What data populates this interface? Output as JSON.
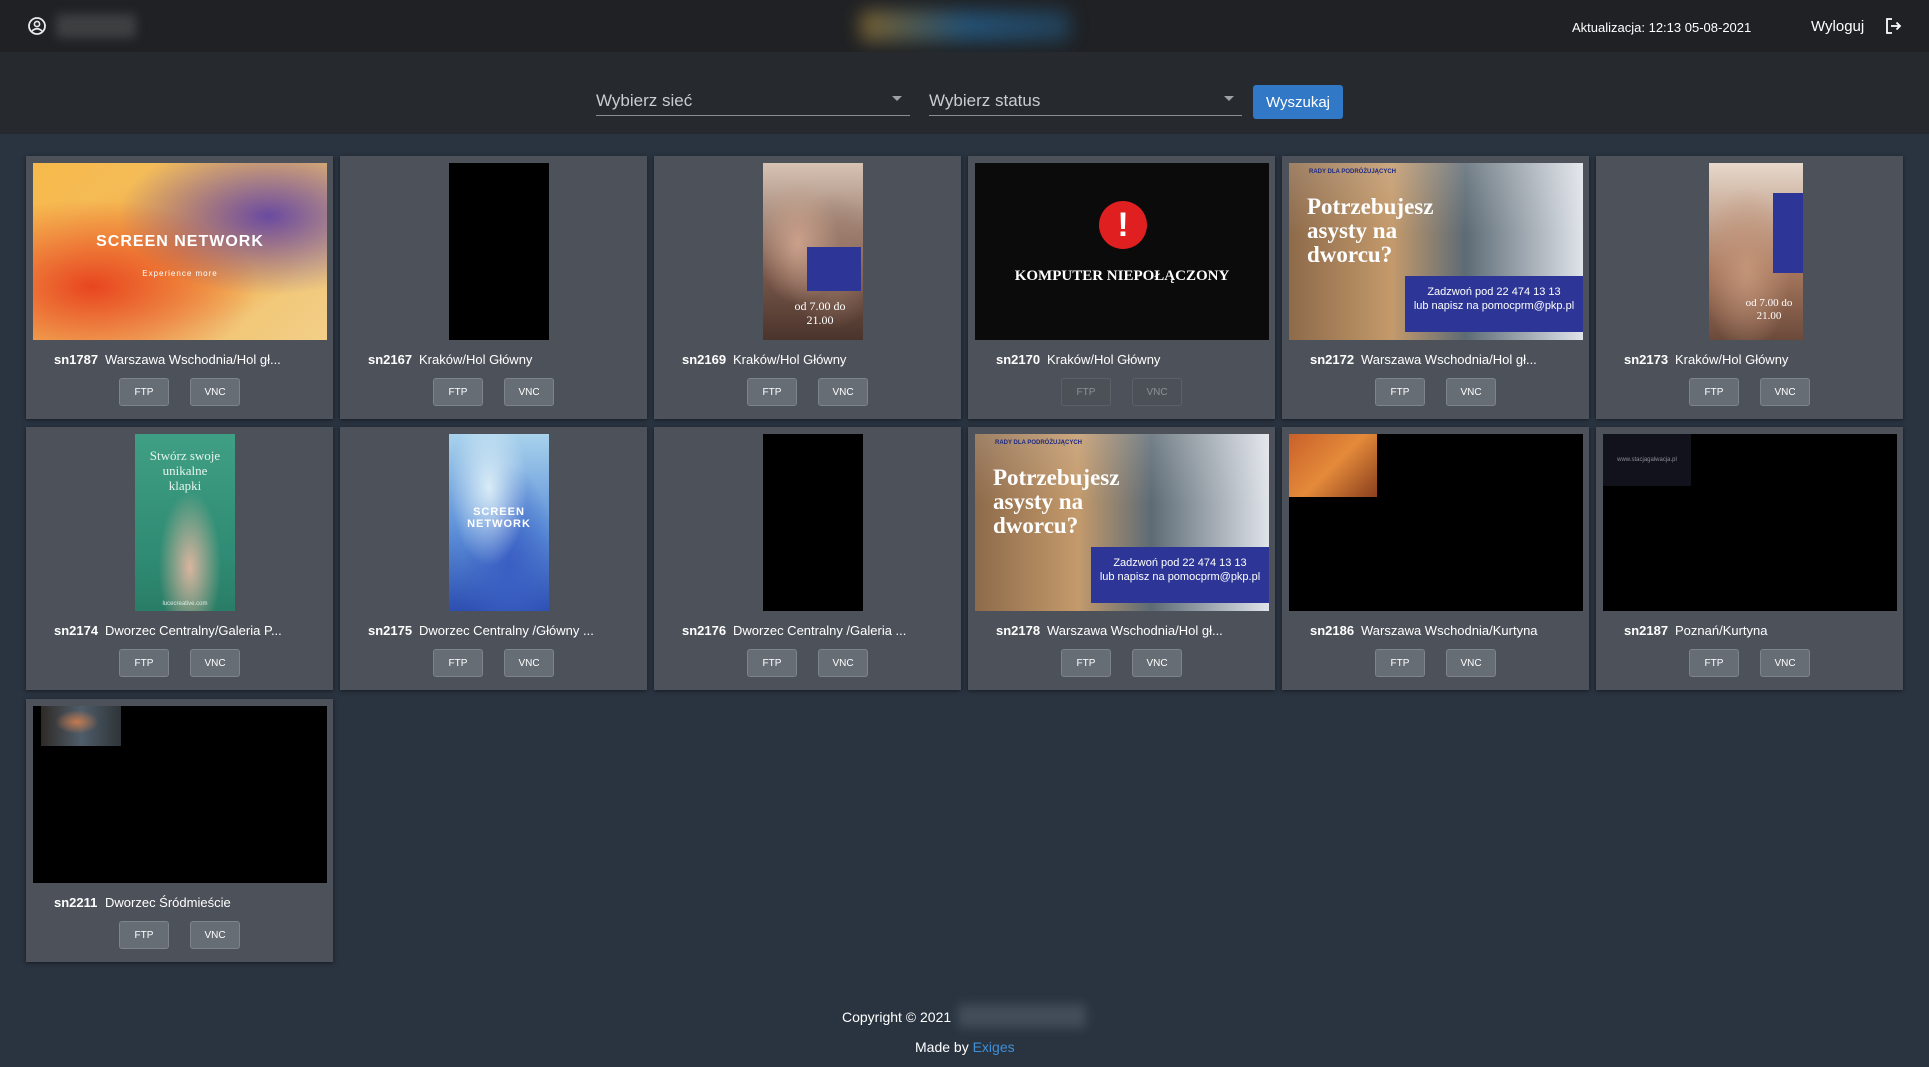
{
  "header": {
    "update_label": "Aktualizacja: 12:13 05-08-2021",
    "logout_label": "Wyloguj"
  },
  "filters": {
    "network_placeholder": "Wybierz sieć",
    "status_placeholder": "Wybierz status",
    "search_label": "Wyszukaj"
  },
  "buttons": {
    "ftp": "FTP",
    "vnc": "VNC"
  },
  "screens": [
    {
      "id": "sn1787",
      "location": "Warszawa Wschodnia/Hol gł...",
      "thumb": "screen-network-orange"
    },
    {
      "id": "sn2167",
      "location": "Kraków/Hol Główny",
      "thumb": "black-portrait"
    },
    {
      "id": "sn2169",
      "location": "Kraków/Hol Główny",
      "thumb": "kids-portrait"
    },
    {
      "id": "sn2170",
      "location": "Kraków/Hol Główny",
      "thumb": "offline",
      "disabled": true
    },
    {
      "id": "sn2172",
      "location": "Warszawa Wschodnia/Hol gł...",
      "thumb": "pkp-ad"
    },
    {
      "id": "sn2173",
      "location": "Kraków/Hol Główny",
      "thumb": "kids-portrait-2"
    },
    {
      "id": "sn2174",
      "location": "Dworzec Centralny/Galeria P...",
      "thumb": "sandal-portrait"
    },
    {
      "id": "sn2175",
      "location": "Dworzec Centralny /Główny ...",
      "thumb": "screen-network-blue"
    },
    {
      "id": "sn2176",
      "location": "Dworzec Centralny /Galeria ...",
      "thumb": "black-portrait"
    },
    {
      "id": "sn2178",
      "location": "Warszawa Wschodnia/Hol gł...",
      "thumb": "pkp-ad"
    },
    {
      "id": "sn2186",
      "location": "Warszawa Wschodnia/Kurtyna",
      "thumb": "black-inset-orange"
    },
    {
      "id": "sn2187",
      "location": "Poznań/Kurtyna",
      "thumb": "black-inset-url"
    },
    {
      "id": "sn2211",
      "location": "Dworzec Śródmieście",
      "thumb": "black-inset-person"
    }
  ],
  "thumb_text": {
    "screen_network": "SCREEN NETWORK",
    "screen_network_sub": "Experience more",
    "offline": "KOMPUTER NIEPOŁĄCZONY",
    "pkp_head": "RADY DLA PODRÓŻUJĄCYCH",
    "pkp_title": "Potrzebujesz asysty na dworcu?",
    "pkp_phone": "Zadzwoń pod 22 474 13 13",
    "pkp_mail": "lub napisz na pomocprm@pkp.pl",
    "kids_hours": "od 7.00 do 21.00",
    "sandal_title": "Stwórz swoje unikalne klapki",
    "sandal_url": "lucecreative.com",
    "poznan_url": "www.stacjagalwacja.pl"
  },
  "footer": {
    "copyright": "Copyright © 2021",
    "made_by_label": "Made by",
    "made_by_link": "Exiges"
  },
  "colors": {
    "topbar": "#1f2124",
    "filterbar": "#26292d",
    "background": "#2a3441",
    "card": "#4d525a",
    "accent": "#3178c6",
    "link": "#3f8fd6"
  }
}
